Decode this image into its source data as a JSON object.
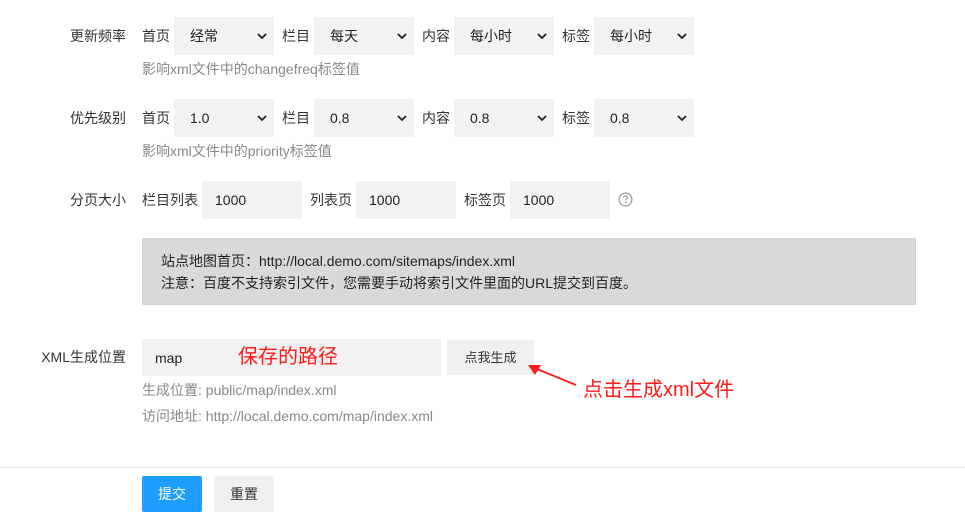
{
  "changefreq": {
    "label": "更新频率",
    "fields": [
      {
        "label": "首页",
        "value": "经常"
      },
      {
        "label": "栏目",
        "value": "每天"
      },
      {
        "label": "内容",
        "value": "每小时"
      },
      {
        "label": "标签",
        "value": "每小时"
      }
    ],
    "hint": "影响xml文件中的changefreq标签值"
  },
  "priority": {
    "label": "优先级别",
    "fields": [
      {
        "label": "首页",
        "value": "1.0"
      },
      {
        "label": "栏目",
        "value": "0.8"
      },
      {
        "label": "内容",
        "value": "0.8"
      },
      {
        "label": "标签",
        "value": "0.8"
      }
    ],
    "hint": "影响xml文件中的priority标签值"
  },
  "pagesize": {
    "label": "分页大小",
    "fields": [
      {
        "label": "栏目列表",
        "value": "1000"
      },
      {
        "label": "列表页",
        "value": "1000"
      },
      {
        "label": "标签页",
        "value": "1000"
      }
    ]
  },
  "notice": {
    "line1": "站点地图首页：http://local.demo.com/sitemaps/index.xml",
    "line2": "注意：百度不支持索引文件，您需要手动将索引文件里面的URL提交到百度。"
  },
  "xml": {
    "label": "XML生成位置",
    "value": "map",
    "button": "点我生成",
    "hint1": "生成位置: public/map/index.xml",
    "hint2": "访问地址: http://local.demo.com/map/index.xml"
  },
  "annotations": {
    "path": "保存的路径",
    "generate": "点击生成xml文件",
    "color": "#ff1a1a"
  },
  "actions": {
    "submit": "提交",
    "reset": "重置"
  },
  "icons": {
    "select_arrow": "chevron-down-icon",
    "help": "question-circle-icon",
    "annotation_arrow": "arrow-icon"
  },
  "colors": {
    "primary": "#1e9fff",
    "notice_bg": "#d9d9d9"
  }
}
